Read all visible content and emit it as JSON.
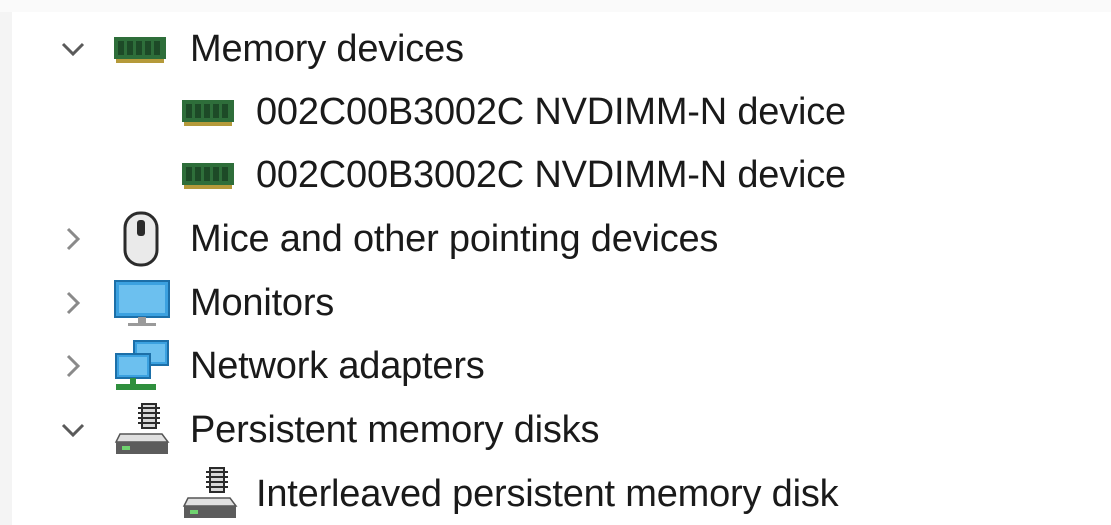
{
  "tree": {
    "items": [
      {
        "label": "Memory devices",
        "icon": "memory-module-icon",
        "expander": "chevron-down-icon"
      },
      {
        "label": "002C00B3002C NVDIMM-N device",
        "icon": "memory-module-icon"
      },
      {
        "label": "002C00B3002C NVDIMM-N device",
        "icon": "memory-module-icon"
      },
      {
        "label": "Mice and other pointing devices",
        "icon": "mouse-icon",
        "expander": "chevron-right-icon"
      },
      {
        "label": "Monitors",
        "icon": "monitor-icon",
        "expander": "chevron-right-icon"
      },
      {
        "label": "Network adapters",
        "icon": "network-adapter-icon",
        "expander": "chevron-right-icon"
      },
      {
        "label": "Persistent memory disks",
        "icon": "persistent-memory-disk-icon",
        "expander": "chevron-down-icon"
      },
      {
        "label": "Interleaved persistent memory disk",
        "icon": "persistent-memory-disk-icon"
      }
    ]
  },
  "colors": {
    "memory_green": "#2e6e3a",
    "monitor_blue": "#3ba1e0",
    "chevron_gray": "#7a7a7a"
  }
}
